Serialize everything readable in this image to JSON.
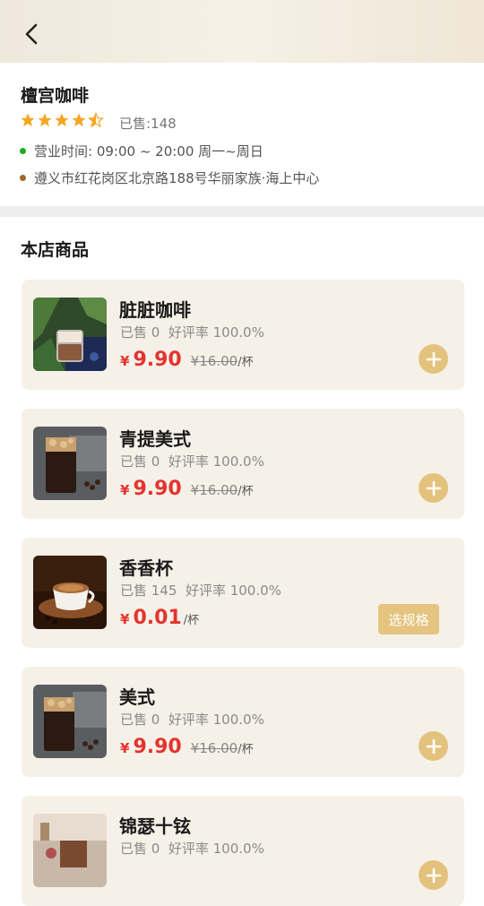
{
  "shop": {
    "name": "檀宫咖啡",
    "rating": 4.5,
    "sold": "已售:148",
    "hours": "营业时间:  09:00 ~ 20:00 周一~周日",
    "address": "遵义市红花岗区北京路188号华丽家族·海上中心",
    "hours_dot_color": "#1aad19",
    "address_dot_color": "#a0672a"
  },
  "section_title": "本店商品",
  "colors": {
    "accent": "#e3c27e",
    "price": "#e3342f",
    "card_bg": "#f6f1e8"
  },
  "products": [
    {
      "name": "脏脏咖啡",
      "sales": "已售 0",
      "rating": "好评率 100.0%",
      "currency": "¥",
      "price": "9.90",
      "original": "¥16.00",
      "unit": "/杯",
      "action": "add",
      "action_icon": "plus-icon"
    },
    {
      "name": "青提美式",
      "sales": "已售 0",
      "rating": "好评率 100.0%",
      "currency": "¥",
      "price": "9.90",
      "original": "¥16.00",
      "unit": "/杯",
      "action": "add",
      "action_icon": "plus-icon"
    },
    {
      "name": "香香杯",
      "sales": "已售 145",
      "rating": "好评率 100.0%",
      "currency": "¥",
      "price": "0.01",
      "original": "",
      "unit": "/杯",
      "action": "spec",
      "action_label": "选规格"
    },
    {
      "name": "美式",
      "sales": "已售 0",
      "rating": "好评率 100.0%",
      "currency": "¥",
      "price": "9.90",
      "original": "¥16.00",
      "unit": "/杯",
      "action": "add",
      "action_icon": "plus-icon"
    },
    {
      "name": "锦瑟十铉",
      "sales": "已售 0",
      "rating": "好评率 100.0%",
      "currency": "¥",
      "price": "",
      "original": "",
      "unit": "",
      "action": "add",
      "action_icon": "plus-icon"
    }
  ]
}
